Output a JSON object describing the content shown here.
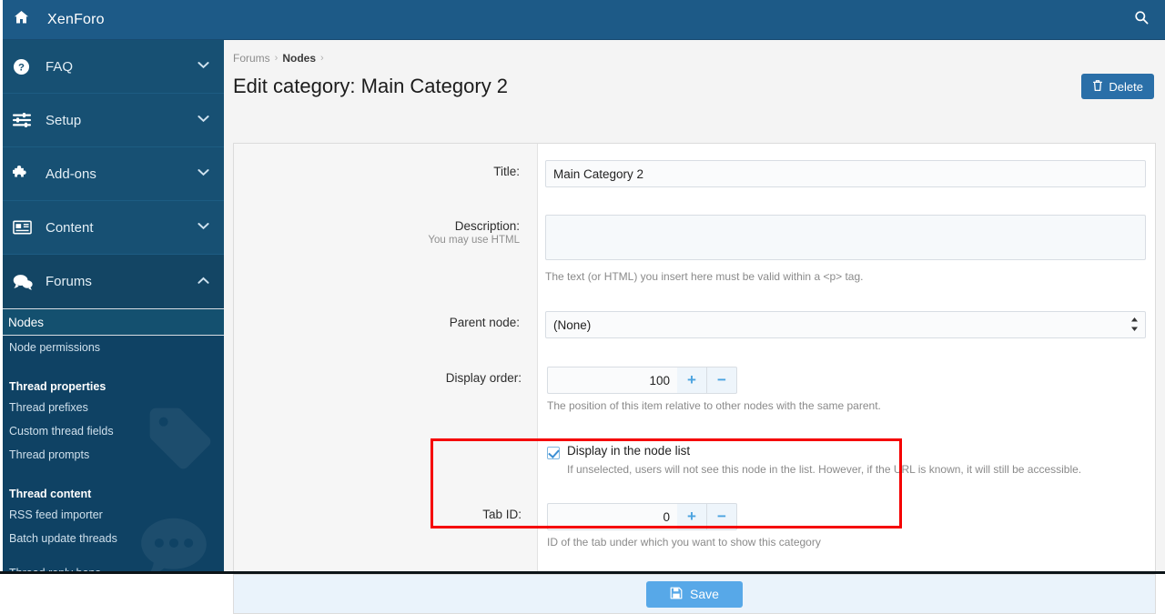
{
  "topbar": {
    "home_icon": "home-icon",
    "title": "XenForo",
    "search_icon": "search-icon"
  },
  "sidebar": {
    "groups": [
      {
        "label": "FAQ",
        "icon": "question-circle-icon",
        "chevron": "chevron-down-icon",
        "expanded": false
      },
      {
        "label": "Setup",
        "icon": "sliders-icon",
        "chevron": "chevron-down-icon",
        "expanded": false
      },
      {
        "label": "Add-ons",
        "icon": "puzzle-piece-icon",
        "chevron": "chevron-down-icon",
        "expanded": false
      },
      {
        "label": "Content",
        "icon": "newspaper-icon",
        "chevron": "chevron-down-icon",
        "expanded": false
      },
      {
        "label": "Forums",
        "icon": "comments-icon",
        "chevron": "chevron-up-icon",
        "expanded": true
      }
    ],
    "sub_items": [
      {
        "type": "item",
        "label": "Nodes",
        "selected": true
      },
      {
        "type": "item",
        "label": "Node permissions",
        "selected": false
      },
      {
        "type": "gap"
      },
      {
        "type": "heading",
        "label": "Thread properties"
      },
      {
        "type": "item",
        "label": "Thread prefixes",
        "selected": false
      },
      {
        "type": "item",
        "label": "Custom thread fields",
        "selected": false
      },
      {
        "type": "item",
        "label": "Thread prompts",
        "selected": false
      },
      {
        "type": "gap"
      },
      {
        "type": "heading",
        "label": "Thread content"
      },
      {
        "type": "item",
        "label": "RSS feed importer",
        "selected": false
      },
      {
        "type": "item",
        "label": "Batch update threads",
        "selected": false
      },
      {
        "type": "gap"
      },
      {
        "type": "item",
        "label": "Thread reply bans",
        "selected": false
      }
    ]
  },
  "breadcrumb": {
    "items": [
      "Forums",
      "Nodes"
    ],
    "separator": "›"
  },
  "page": {
    "title": "Edit category: Main Category 2",
    "delete_label": "Delete",
    "delete_icon": "trash-icon"
  },
  "form": {
    "title_field": {
      "label": "Title:",
      "value": "Main Category 2",
      "placeholder": ""
    },
    "description_field": {
      "label": "Description:",
      "sublabel": "You may use HTML",
      "value": "",
      "placeholder": "",
      "explain": "The text (or HTML) you insert here must be valid within a <p> tag."
    },
    "parent_node": {
      "label": "Parent node:",
      "value": "(None)",
      "options": [
        "(None)"
      ],
      "arrow_icon": "chevron-updown-icon"
    },
    "display_order": {
      "label": "Display order:",
      "value": "100",
      "plus_label": "+",
      "minus_label": "−",
      "explain": "The position of this item relative to other nodes with the same parent."
    },
    "display_in_node_list": {
      "label": "Display in the node list",
      "checked": true,
      "explain": "If unselected, users will not see this node in the list. However, if the URL is known, it will still be accessible."
    },
    "tab_id": {
      "label": "Tab ID:",
      "value": "0",
      "plus_label": "+",
      "minus_label": "−",
      "explain": "ID of the tab under which you want to show this category"
    },
    "save_label": "Save",
    "save_icon": "floppy-disk-icon"
  },
  "annotation": {
    "highlight_color": "#f50000",
    "target": "tab-id-row"
  },
  "colors": {
    "header_blue": "#1d5a87",
    "sidebar_blue": "#175073",
    "sidebar_sub_blue": "#0f4264",
    "accent_blue": "#4aa6e0",
    "button_blue": "#2a6fa8",
    "save_blue": "#57a8e8"
  }
}
